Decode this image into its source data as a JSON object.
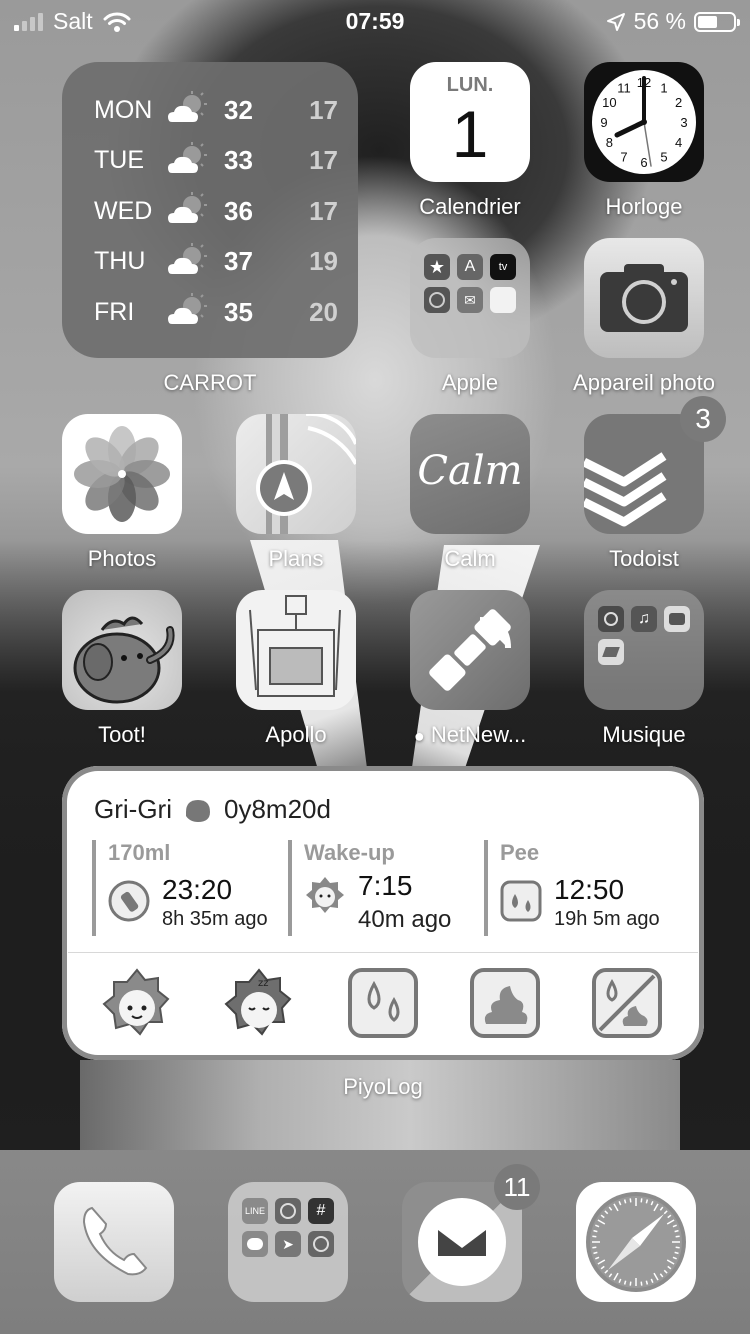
{
  "status_bar": {
    "carrier": "Salt",
    "time": "07:59",
    "battery": "56 %",
    "battery_level": 0.56
  },
  "weather_widget": {
    "label": "CARROT",
    "rows": [
      {
        "day": "MON",
        "icon": "partly-cloudy-icon",
        "high": "32",
        "low": "17"
      },
      {
        "day": "TUE",
        "icon": "partly-cloudy-icon",
        "high": "33",
        "low": "17"
      },
      {
        "day": "WED",
        "icon": "partly-cloudy-icon",
        "high": "36",
        "low": "17"
      },
      {
        "day": "THU",
        "icon": "partly-cloudy-icon",
        "high": "37",
        "low": "19"
      },
      {
        "day": "FRI",
        "icon": "partly-cloudy-icon",
        "high": "35",
        "low": "20"
      }
    ]
  },
  "apps": {
    "calendar": {
      "label": "Calendrier",
      "weekday": "LUN.",
      "day": "1"
    },
    "clock": {
      "label": "Horloge",
      "numerals": [
        "12",
        "1",
        "2",
        "3",
        "4",
        "5",
        "6",
        "7",
        "8",
        "9",
        "10",
        "11"
      ]
    },
    "apple_folder": {
      "label": "Apple"
    },
    "camera": {
      "label": "Appareil photo"
    },
    "photos": {
      "label": "Photos"
    },
    "maps": {
      "label": "Plans"
    },
    "calm": {
      "label": "Calm",
      "logo_text": "Calm"
    },
    "todoist": {
      "label": "Todoist",
      "badge": "3"
    },
    "toot": {
      "label": "Toot!"
    },
    "apollo": {
      "label": "Apollo"
    },
    "netnewswire": {
      "label": "NetNew...",
      "dot": "●"
    },
    "music_folder": {
      "label": "Musique"
    }
  },
  "piyolog": {
    "label": "PiyoLog",
    "baby_name": "Gri-Gri",
    "age": "0y8m20d",
    "entries": [
      {
        "caption": "170ml",
        "time": "23:20",
        "ago": "8h 35m ago",
        "icon": "bottle-icon"
      },
      {
        "caption": "Wake-up",
        "time": "7:15",
        "ago": "40m ago",
        "icon": "wake-up-icon"
      },
      {
        "caption": "Pee",
        "time": "12:50",
        "ago": "19h 5m ago",
        "icon": "pee-icon"
      }
    ],
    "actions": [
      "wake-up-action-icon",
      "sleep-action-icon",
      "pee-action-icon",
      "poop-action-icon",
      "no-diaper-action-icon"
    ]
  },
  "dock": {
    "phone": {
      "icon": "phone-icon"
    },
    "messaging_folder": {
      "icon": "folder-icon"
    },
    "mail": {
      "icon": "mail-icon",
      "badge": "11"
    },
    "safari": {
      "icon": "compass-icon"
    }
  }
}
